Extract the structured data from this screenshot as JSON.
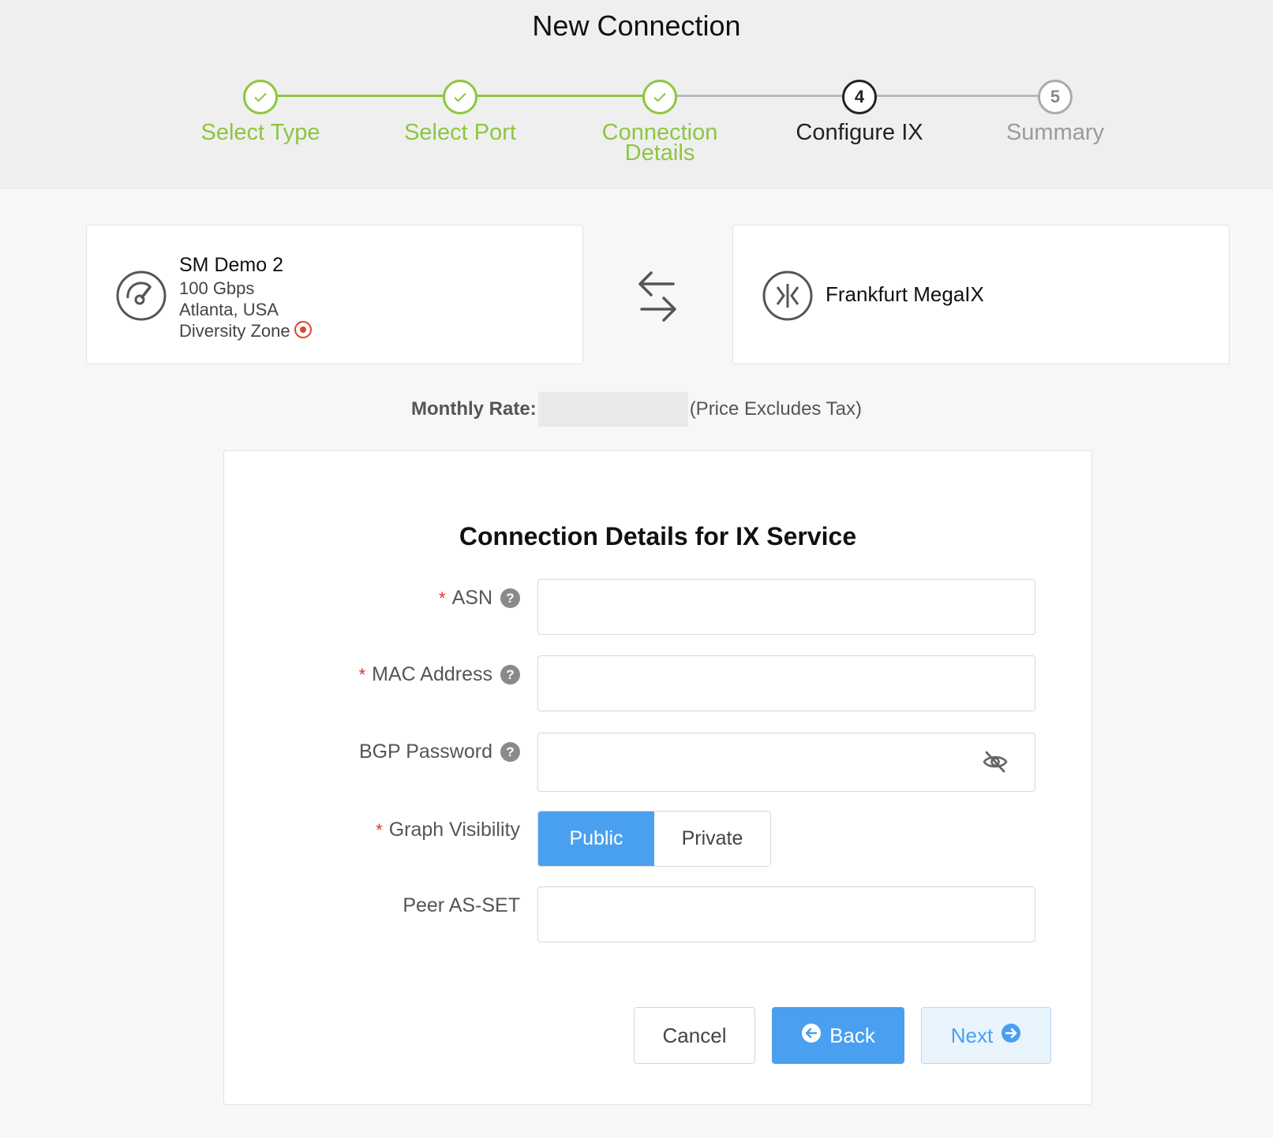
{
  "header": {
    "title": "New Connection"
  },
  "steps": [
    {
      "label": "Select Type",
      "state": "done"
    },
    {
      "label": "Select Port",
      "state": "done"
    },
    {
      "label": "Connection Details",
      "label_line1": "Connection",
      "label_line2": "Details",
      "state": "done"
    },
    {
      "label": "Configure IX",
      "number": "4",
      "state": "current"
    },
    {
      "label": "Summary",
      "number": "5",
      "state": "todo"
    }
  ],
  "source": {
    "name": "SM Demo 2",
    "speed": "100 Gbps",
    "location": "Atlanta, USA",
    "zone": "Diversity Zone",
    "icon": "speedometer-icon",
    "zone_icon": "diversity-zone-red-icon"
  },
  "destination": {
    "name": "Frankfurt MegaIX",
    "icon": "ix-icon"
  },
  "pricing": {
    "label": "Monthly Rate:",
    "value": "",
    "note": "(Price Excludes Tax)"
  },
  "form": {
    "title": "Connection Details for IX Service",
    "fields": {
      "asn": {
        "label": "ASN",
        "required": true,
        "value": "",
        "placeholder": ""
      },
      "mac": {
        "label": "MAC Address",
        "required": true,
        "value": "",
        "placeholder": ""
      },
      "bgp": {
        "label": "BGP Password",
        "required": false,
        "value": "",
        "placeholder": ""
      },
      "graph": {
        "label": "Graph Visibility",
        "required": true,
        "options": [
          "Public",
          "Private"
        ],
        "selected": "Public"
      },
      "peer": {
        "label": "Peer AS-SET",
        "required": false,
        "value": "",
        "placeholder": ""
      }
    },
    "required_marker": "*",
    "help_marker": "?"
  },
  "actions": {
    "cancel": "Cancel",
    "back": "Back",
    "next": "Next"
  },
  "colors": {
    "accent_green": "#8dc63f",
    "primary_blue": "#4a9ff0",
    "required_red": "#d9342b"
  }
}
